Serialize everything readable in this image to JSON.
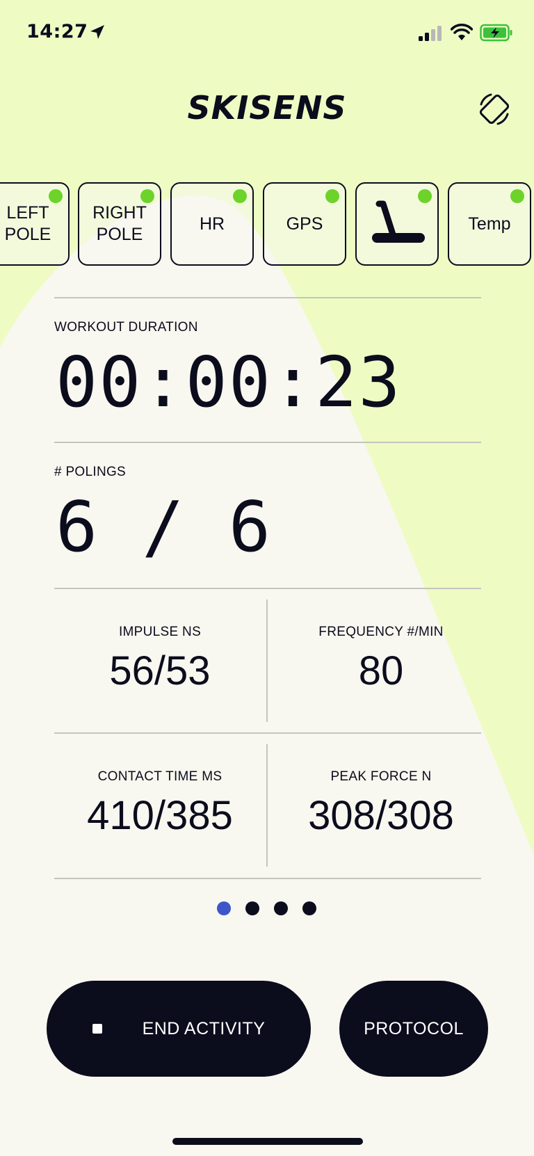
{
  "status_bar": {
    "time": "14:27",
    "battery_color": "#3dc13c"
  },
  "header": {
    "logo": "SKISENS",
    "rotate_icon": "screen-rotation-icon"
  },
  "sensors": [
    {
      "label": "LEFT\nPOLE",
      "connected": true
    },
    {
      "label": "RIGHT\nPOLE",
      "connected": true
    },
    {
      "label": "HR",
      "connected": true
    },
    {
      "label": "GPS",
      "connected": true
    },
    {
      "label": "",
      "icon": "treadmill-icon",
      "connected": true
    },
    {
      "label": "Temp",
      "connected": true
    }
  ],
  "metrics": {
    "duration": {
      "label": "WORKOUT DURATION",
      "value": "00:00:23"
    },
    "polings": {
      "label": "# POLINGS",
      "value": "6 / 6"
    },
    "impulse": {
      "label": "IMPULSE NS",
      "value": "56/53"
    },
    "frequency": {
      "label": "FREQUENCY #/MIN",
      "value": "80"
    },
    "contact_time": {
      "label": "CONTACT TIME MS",
      "value": "410/385"
    },
    "peak_force": {
      "label": "PEAK FORCE N",
      "value": "308/308"
    }
  },
  "pager": {
    "pages": 4,
    "active_index": 0
  },
  "actions": {
    "end_label": "END ACTIVITY",
    "protocol_label": "PROTOCOL"
  },
  "colors": {
    "background": "#f8f7f0",
    "accent_swoosh": "#eefcc4",
    "ink": "#0b0c1c",
    "connected_dot": "#6dd32a",
    "pager_active": "#3d55c9"
  }
}
